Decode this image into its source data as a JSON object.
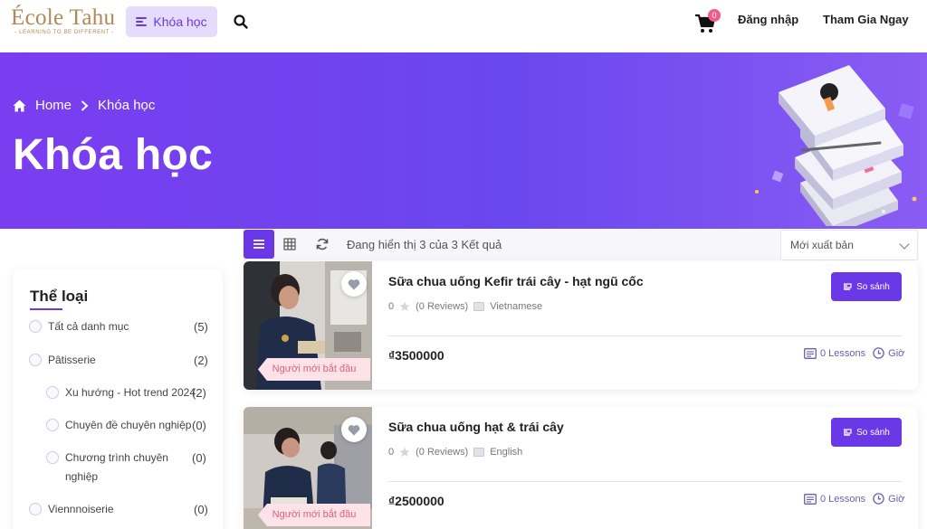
{
  "header": {
    "logo_text": "École Tahu",
    "logo_tagline": "- LEARNING TO BE DIFFERENT -",
    "nav_label": "Khóa học",
    "cart_count": "0",
    "login_label": "Đăng nhập",
    "join_label": "Tham Gia Ngay"
  },
  "hero": {
    "breadcrumb_home": "Home",
    "breadcrumb_current": "Khóa học",
    "title": "Khóa học"
  },
  "toolbar": {
    "result_text": "Đang hiển thị 3 của 3 Kết quả",
    "sort_selected": "Mới xuất bản"
  },
  "sidebar": {
    "title": "Thể loại",
    "categories": [
      {
        "label": "Tất cả danh mục",
        "count": "(5)"
      },
      {
        "label": "Pâtisserie",
        "count": "(2)"
      },
      {
        "label": "Xu hướng - Hot trend 2024",
        "count": "(2)"
      },
      {
        "label": "Chuyên đề chuyên nghiệp",
        "count": "(0)"
      },
      {
        "label": "Chương trình chuyên",
        "label2": "nghiệp",
        "count": "(0)"
      },
      {
        "label": "Viennnoiserie",
        "count": "(0)"
      }
    ]
  },
  "courses": [
    {
      "title": "Sữa chua uống Kefir trái cây - hạt ngũ cốc",
      "rating": "0",
      "reviews": "(0 Reviews)",
      "language": "Vietnamese",
      "compare_label": "So sánh",
      "price": "₫3500000",
      "lessons": "0 Lessons",
      "duration": "Giờ",
      "level": "Người mới bắt đầu"
    },
    {
      "title": "Sữa chua uống hạt & trái cây",
      "rating": "0",
      "reviews": "(0 Reviews)",
      "language": "English",
      "compare_label": "So sánh",
      "price": "₫2500000",
      "lessons": "0 Lessons",
      "duration": "Giờ",
      "level": "Người mới bắt đầu"
    }
  ],
  "colors": {
    "accent": "#6b38e8",
    "hero_start": "#7a3df0",
    "hero_end": "#8a5cf4",
    "tag_bg": "#fde2ea",
    "tag_text": "#e0607e",
    "logo": "#b08a55"
  }
}
